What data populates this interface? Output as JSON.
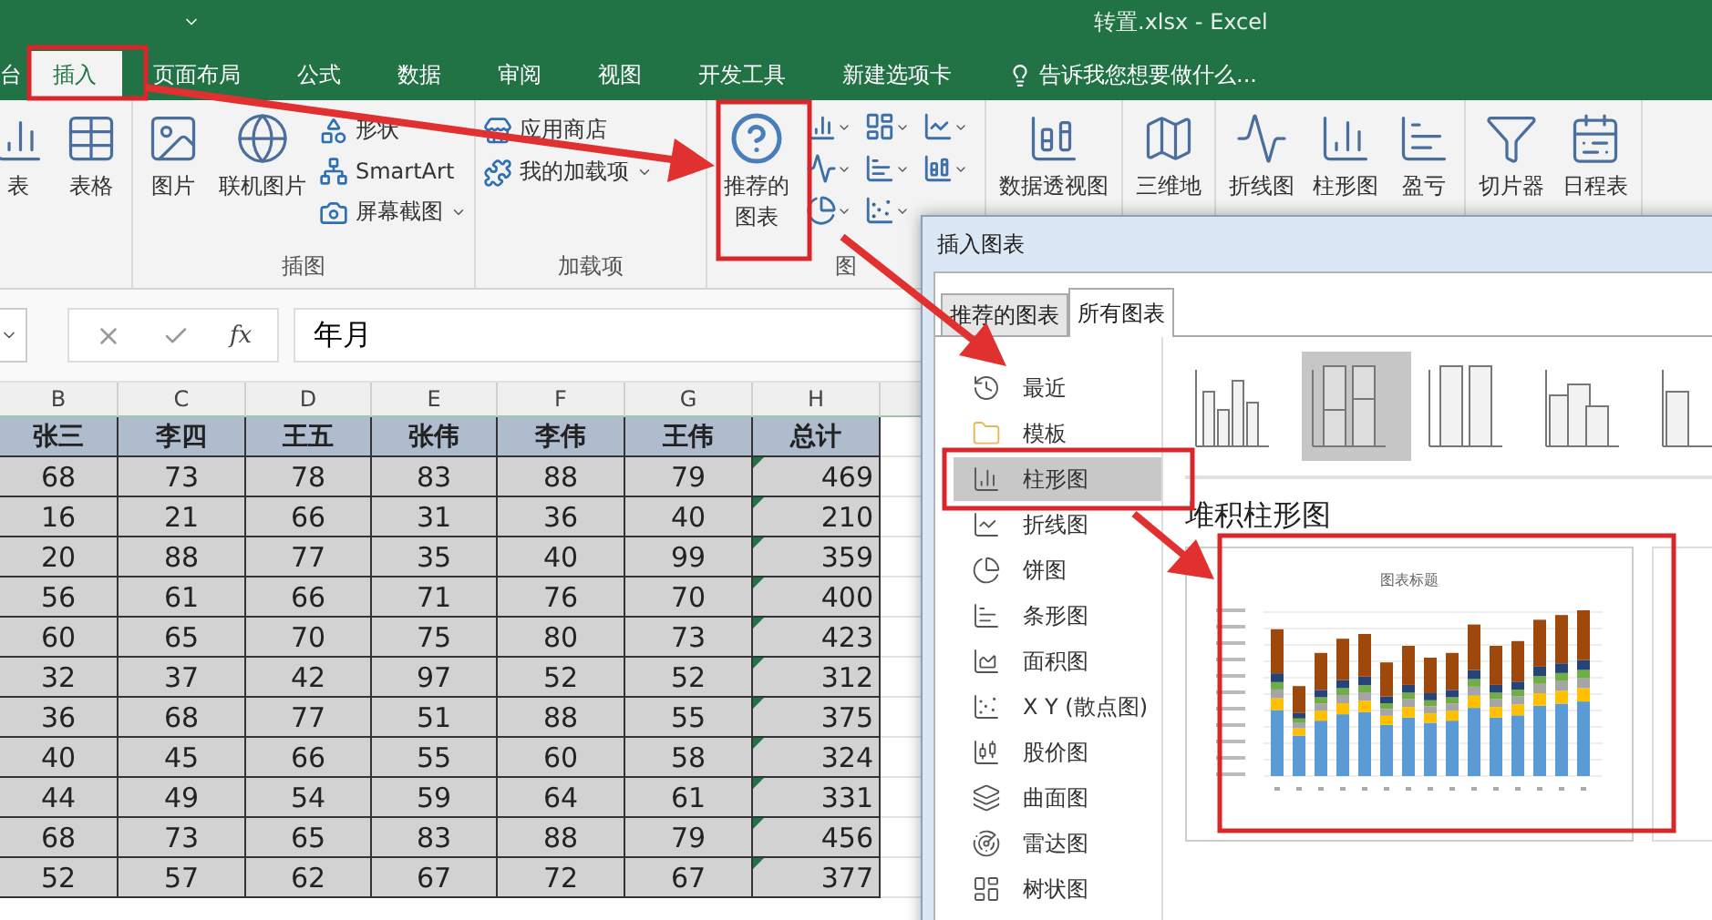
{
  "window": {
    "title": "转置.xlsx - Excel"
  },
  "tabs": [
    {
      "label": "台",
      "selected": false
    },
    {
      "label": "插入",
      "selected": true
    },
    {
      "label": "页面布局",
      "selected": false
    },
    {
      "label": "公式",
      "selected": false
    },
    {
      "label": "数据",
      "selected": false
    },
    {
      "label": "审阅",
      "selected": false
    },
    {
      "label": "视图",
      "selected": false
    },
    {
      "label": "开发工具",
      "selected": false
    },
    {
      "label": "新建选项卡",
      "selected": false
    }
  ],
  "tell_me": "告诉我您想要做什么...",
  "ribbon": {
    "groups": [
      {
        "items": [
          {
            "label": "表"
          },
          {
            "label": "表格"
          }
        ]
      },
      {
        "label": "插图",
        "items": [
          {
            "label": "图片"
          },
          {
            "label": "联机图片"
          }
        ],
        "small_items": [
          {
            "label": "形状",
            "dropdown": false
          },
          {
            "label": "SmartArt",
            "dropdown": false
          },
          {
            "label": "屏幕截图",
            "dropdown": true
          }
        ]
      },
      {
        "label": "加载项",
        "small_items": [
          {
            "label": "应用商店",
            "dropdown": false
          },
          {
            "label": "我的加载项",
            "dropdown": true
          }
        ]
      },
      {
        "label": "图",
        "items": [
          {
            "label": "推荐的图表"
          }
        ],
        "chart_buttons": true
      },
      {
        "items": [
          {
            "label": "数据透视图"
          }
        ]
      },
      {
        "items": [
          {
            "label": "三维地"
          }
        ]
      },
      {
        "items": [
          {
            "label": "折线图"
          },
          {
            "label": "柱形图"
          },
          {
            "label": "盈亏"
          }
        ]
      },
      {
        "items": [
          {
            "label": "切片器"
          },
          {
            "label": "日程表"
          }
        ]
      }
    ]
  },
  "formula_bar": {
    "function_label": "fx",
    "value": "年月"
  },
  "sheet": {
    "columns": [
      "B",
      "C",
      "D",
      "E",
      "F",
      "G",
      "H"
    ],
    "range_selected": true,
    "header": [
      "张三",
      "李四",
      "王五",
      "张伟",
      "李伟",
      "王伟",
      "总计"
    ],
    "rows": [
      [
        "68",
        "73",
        "78",
        "83",
        "88",
        "79",
        "469"
      ],
      [
        "16",
        "21",
        "66",
        "31",
        "36",
        "40",
        "210"
      ],
      [
        "20",
        "88",
        "77",
        "35",
        "40",
        "99",
        "359"
      ],
      [
        "56",
        "61",
        "66",
        "71",
        "76",
        "70",
        "400"
      ],
      [
        "60",
        "65",
        "70",
        "75",
        "80",
        "73",
        "423"
      ],
      [
        "32",
        "37",
        "42",
        "97",
        "52",
        "52",
        "312"
      ],
      [
        "36",
        "68",
        "77",
        "51",
        "88",
        "55",
        "375"
      ],
      [
        "40",
        "45",
        "66",
        "55",
        "60",
        "58",
        "324"
      ],
      [
        "44",
        "49",
        "54",
        "59",
        "64",
        "61",
        "331"
      ],
      [
        "68",
        "73",
        "65",
        "83",
        "88",
        "79",
        "456"
      ],
      [
        "52",
        "57",
        "62",
        "67",
        "72",
        "67",
        "377"
      ]
    ]
  },
  "dialog": {
    "title": "插入图表",
    "tabs": [
      {
        "label": "推荐的图表",
        "selected": false
      },
      {
        "label": "所有图表",
        "selected": true
      }
    ],
    "categories": [
      {
        "label": "最近",
        "selected": false
      },
      {
        "label": "模板",
        "selected": false
      },
      {
        "label": "柱形图",
        "selected": true
      },
      {
        "label": "折线图",
        "selected": false
      },
      {
        "label": "饼图",
        "selected": false
      },
      {
        "label": "条形图",
        "selected": false
      },
      {
        "label": "面积图",
        "selected": false
      },
      {
        "label": "X Y (散点图)",
        "selected": false
      },
      {
        "label": "股价图",
        "selected": false
      },
      {
        "label": "曲面图",
        "selected": false
      },
      {
        "label": "雷达图",
        "selected": false
      },
      {
        "label": "树状图",
        "selected": false
      }
    ],
    "subtypes": [
      {
        "selected": false
      },
      {
        "selected": true
      },
      {
        "selected": false
      },
      {
        "selected": false
      },
      {
        "selected": false
      }
    ],
    "subtype_title": "堆积柱形图",
    "preview_title": "图表标题"
  }
}
